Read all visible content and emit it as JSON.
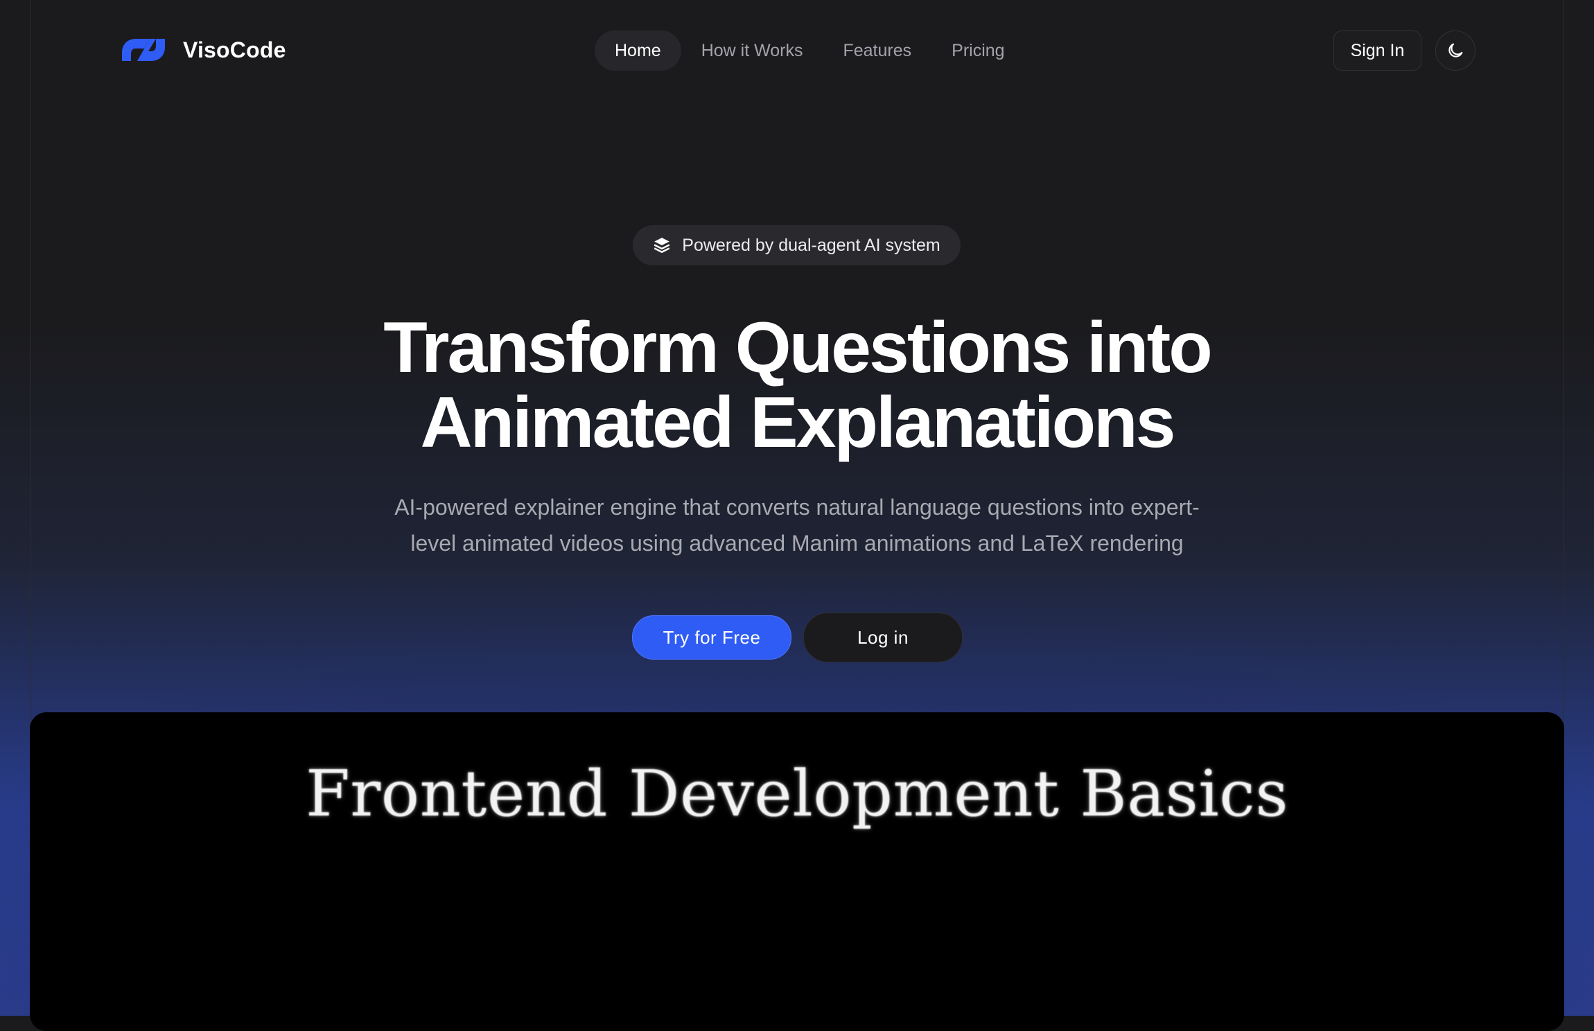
{
  "brand": {
    "name": "VisoCode",
    "logo_icon": "visocode-logo-icon",
    "accent_color": "#2f5cf5"
  },
  "nav": {
    "items": [
      {
        "label": "Home",
        "active": true
      },
      {
        "label": "How it Works",
        "active": false
      },
      {
        "label": "Features",
        "active": false
      },
      {
        "label": "Pricing",
        "active": false
      }
    ]
  },
  "header_actions": {
    "signin_label": "Sign In",
    "theme_icon": "moon-icon"
  },
  "hero": {
    "badge_icon": "layers-icon",
    "badge_text": "Powered by dual-agent AI system",
    "title_line1": "Transform Questions into",
    "title_line2": "Animated Explanations",
    "subtitle_line1": "AI-powered explainer engine that converts natural language questions into expert-",
    "subtitle_line2": "level animated videos using advanced Manim animations and LaTeX rendering",
    "cta_primary": "Try for Free",
    "cta_secondary": "Log in"
  },
  "video": {
    "title": "Frontend Development Basics"
  }
}
